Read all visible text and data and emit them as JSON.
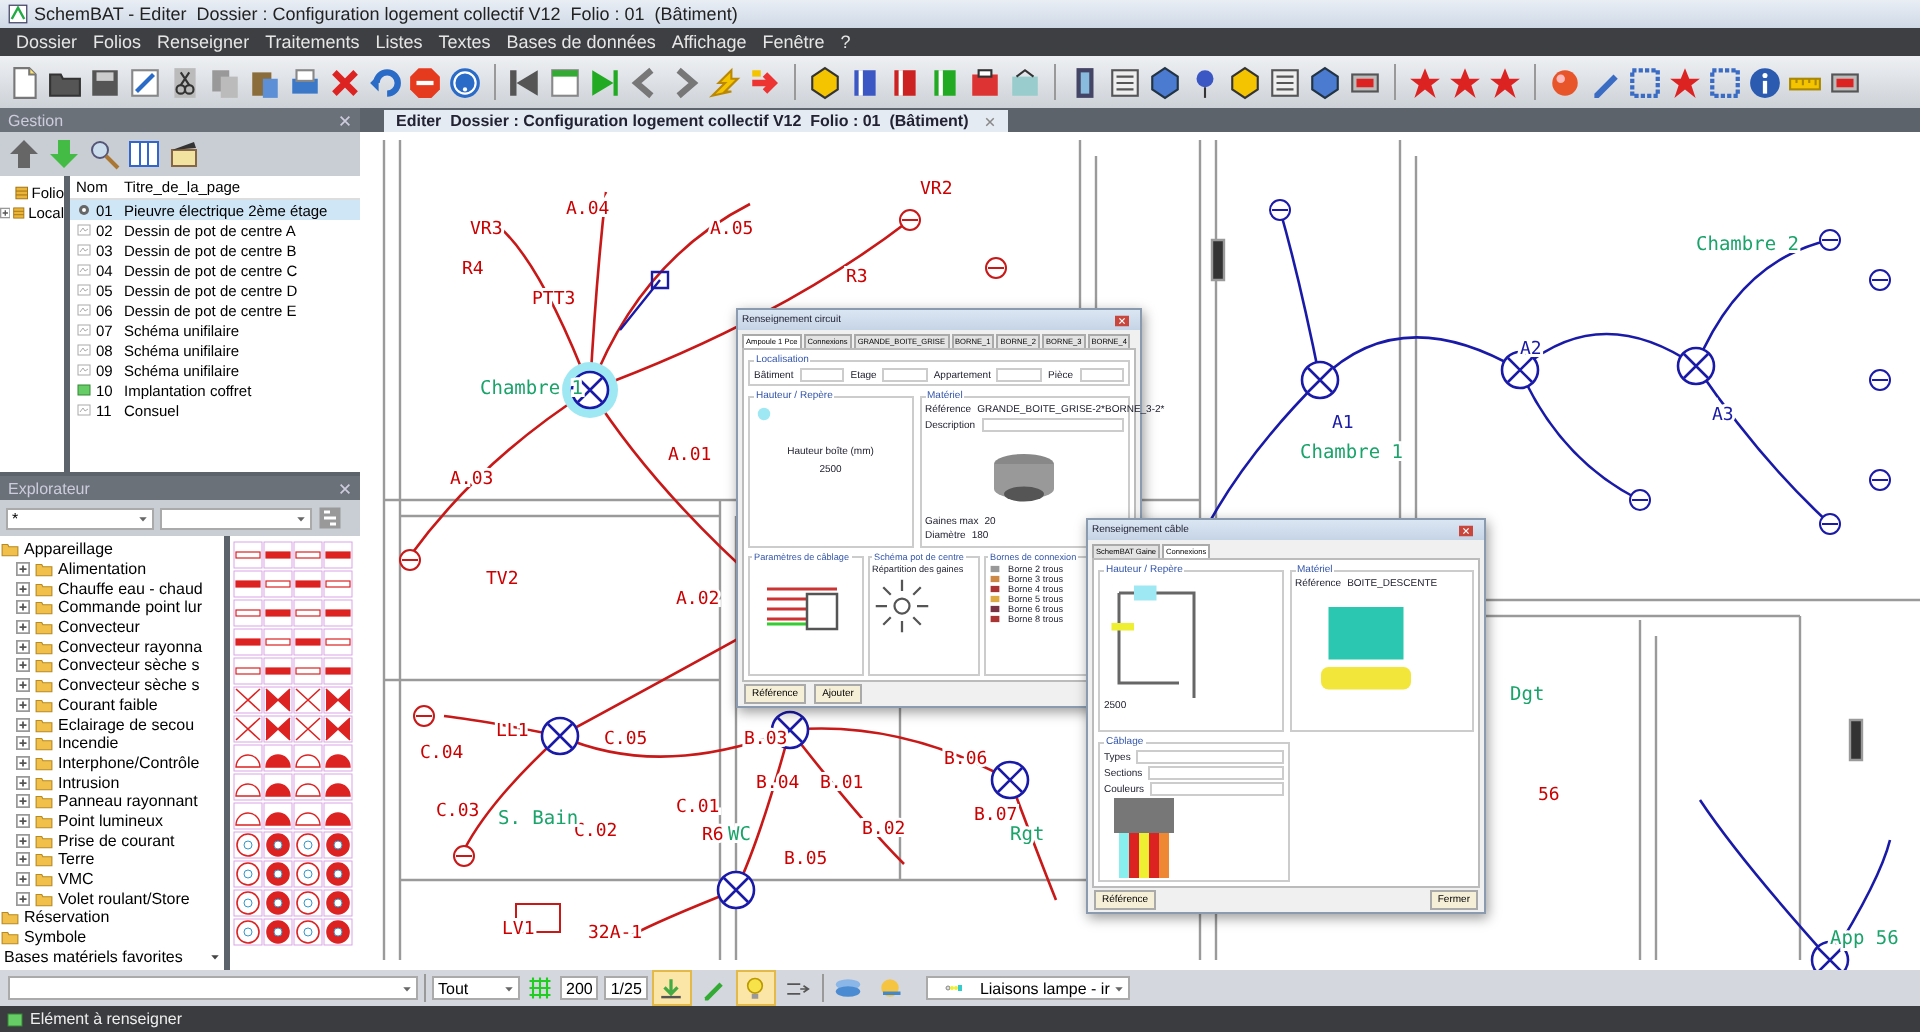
{
  "window": {
    "title": "SchemBAT - Editer  Dossier : Configuration logement collectif V12  Folio : 01  (Bâtiment)"
  },
  "menu": [
    "Dossier",
    "Folios",
    "Renseigner",
    "Traitements",
    "Listes",
    "Textes",
    "Bases de données",
    "Affichage",
    "Fenêtre",
    "?"
  ],
  "gestion": {
    "title": "Gestion",
    "tree": [
      {
        "label": "Folio"
      },
      {
        "label": "Local",
        "expanded": false
      }
    ],
    "columns": [
      "Nom",
      "Titre_de_la_page"
    ],
    "rows": [
      {
        "num": "01",
        "title": "Pieuvre électrique 2ème étage",
        "kind": "main",
        "selected": true
      },
      {
        "num": "02",
        "title": "Dessin de pot de centre A",
        "kind": "sheet",
        "selected": false
      },
      {
        "num": "03",
        "title": "Dessin de pot de centre B",
        "kind": "sheet",
        "selected": false
      },
      {
        "num": "04",
        "title": "Dessin de pot de centre C",
        "kind": "sheet",
        "selected": false
      },
      {
        "num": "05",
        "title": "Dessin de pot de centre D",
        "kind": "sheet",
        "selected": false
      },
      {
        "num": "06",
        "title": "Dessin de pot de centre E",
        "kind": "sheet",
        "selected": false
      },
      {
        "num": "07",
        "title": "Schéma unifilaire",
        "kind": "sheet",
        "selected": false
      },
      {
        "num": "08",
        "title": "Schéma unifilaire",
        "kind": "sheet",
        "selected": false
      },
      {
        "num": "09",
        "title": "Schéma unifilaire",
        "kind": "sheet",
        "selected": false
      },
      {
        "num": "10",
        "title": "Implantation coffret",
        "kind": "plan",
        "selected": false
      },
      {
        "num": "11",
        "title": "Consuel",
        "kind": "sheet",
        "selected": false
      }
    ]
  },
  "explorer": {
    "title": "Explorateur",
    "filter": "*",
    "tree": [
      {
        "label": "Appareillage",
        "children": [
          {
            "label": "Alimentation",
            "expanded": false
          },
          {
            "label": "Chauffe eau - chaud",
            "expanded": false
          },
          {
            "label": "Commande point lur",
            "expanded": false
          },
          {
            "label": "Convecteur",
            "expanded": false
          },
          {
            "label": "Convecteur rayonna",
            "expanded": false
          },
          {
            "label": "Convecteur sèche s",
            "expanded": false
          },
          {
            "label": "Convecteur sèche s",
            "expanded": false
          },
          {
            "label": "Courant faible",
            "expanded": false
          },
          {
            "label": "Eclairage de secou",
            "expanded": false
          },
          {
            "label": "Incendie",
            "expanded": false
          },
          {
            "label": "Interphone/Contrôle",
            "expanded": false
          },
          {
            "label": "Intrusion",
            "expanded": false
          },
          {
            "label": "Panneau rayonnant",
            "expanded": false
          },
          {
            "label": "Point lumineux",
            "expanded": false
          },
          {
            "label": "Prise de courant",
            "expanded": false
          },
          {
            "label": "Terre",
            "expanded": false
          },
          {
            "label": "VMC",
            "expanded": false
          },
          {
            "label": "Volet roulant/Store",
            "expanded": false
          }
        ]
      },
      {
        "label": "Réservation"
      },
      {
        "label": "Symbole"
      }
    ],
    "favorites": "Bases matériels favorites"
  },
  "document_tab": {
    "title": "Editer  Dossier : Configuration logement collectif V12  Folio : 01  (Bâtiment)"
  },
  "canvas": {
    "labels": [
      {
        "text": "VR3",
        "kind": "circuit",
        "color": "#cc0000"
      },
      {
        "text": "R4",
        "kind": "circuit",
        "color": "#cc0000"
      },
      {
        "text": "PTT3",
        "kind": "circuit",
        "color": "#cc0000"
      },
      {
        "text": "A.04",
        "kind": "circuit",
        "color": "#cc0000"
      },
      {
        "text": "A.05",
        "kind": "circuit",
        "color": "#cc0000"
      },
      {
        "text": "VR2",
        "kind": "circuit",
        "color": "#cc0000"
      },
      {
        "text": "R3",
        "kind": "circuit",
        "color": "#cc0000"
      },
      {
        "text": "Chambre 1",
        "kind": "room",
        "color": "#1aa36a"
      },
      {
        "text": "A.03",
        "kind": "circuit",
        "color": "#cc0000"
      },
      {
        "text": "A.01",
        "kind": "circuit",
        "color": "#cc0000"
      },
      {
        "text": "TV2",
        "kind": "circuit",
        "color": "#cc0000"
      },
      {
        "text": "A.02",
        "kind": "circuit",
        "color": "#cc0000"
      },
      {
        "text": "LL1",
        "kind": "circuit",
        "color": "#cc0000"
      },
      {
        "text": "C.04",
        "kind": "circuit",
        "color": "#cc0000"
      },
      {
        "text": "C.03",
        "kind": "circuit",
        "color": "#cc0000"
      },
      {
        "text": "C.05",
        "kind": "circuit",
        "color": "#cc0000"
      },
      {
        "text": "C.02",
        "kind": "circuit",
        "color": "#cc0000"
      },
      {
        "text": "C.01",
        "kind": "circuit",
        "color": "#cc0000"
      },
      {
        "text": "S. Bain",
        "kind": "room",
        "color": "#1aa36a"
      },
      {
        "text": "R6",
        "kind": "circuit",
        "color": "#cc0000"
      },
      {
        "text": "WC",
        "kind": "room",
        "color": "#1aa36a"
      },
      {
        "text": "B.03",
        "kind": "circuit",
        "color": "#cc0000"
      },
      {
        "text": "B.04",
        "kind": "circuit",
        "color": "#cc0000"
      },
      {
        "text": "B.05",
        "kind": "circuit",
        "color": "#cc0000"
      },
      {
        "text": "B.01",
        "kind": "circuit",
        "color": "#cc0000"
      },
      {
        "text": "B.02",
        "kind": "circuit",
        "color": "#cc0000"
      },
      {
        "text": "B.06",
        "kind": "circuit",
        "color": "#cc0000"
      },
      {
        "text": "B.07",
        "kind": "circuit",
        "color": "#cc0000"
      },
      {
        "text": "Rgt",
        "kind": "room",
        "color": "#1aa36a"
      },
      {
        "text": "LV1",
        "kind": "circuit",
        "color": "#cc0000"
      },
      {
        "text": "32A-1",
        "kind": "circuit",
        "color": "#cc0000"
      },
      {
        "text": "Chambre 2",
        "kind": "room",
        "color": "#1aa36a"
      },
      {
        "text": "A1",
        "kind": "circuit",
        "color": "#1a1aa8"
      },
      {
        "text": "A2",
        "kind": "circuit",
        "color": "#1a1aa8"
      },
      {
        "text": "A3",
        "kind": "circuit",
        "color": "#1a1aa8"
      },
      {
        "text": "Chambre 1",
        "kind": "room",
        "color": "#1aa36a"
      },
      {
        "text": "Dgt",
        "kind": "room",
        "color": "#1aa36a"
      },
      {
        "text": "56",
        "kind": "circuit",
        "color": "#cc0000"
      },
      {
        "text": "App 56",
        "kind": "room",
        "color": "#1aa36a"
      }
    ]
  },
  "dialogs": [
    {
      "kind": "circuit",
      "title": "Renseignement circuit",
      "tabs": [
        {
          "label": "Ampoule 1 Pce",
          "selected": true
        },
        {
          "label": "Connexions",
          "selected": false
        },
        {
          "label": "GRANDE_BOITE_GRISE",
          "selected": false
        },
        {
          "label": "BORNE_1",
          "selected": false
        },
        {
          "label": "BORNE_2",
          "selected": false
        },
        {
          "label": "BORNE_3",
          "selected": false
        },
        {
          "label": "BORNE_4",
          "selected": false
        }
      ],
      "localisation": {
        "title": "Localisation",
        "fields": [
          "Bâtiment",
          "Etage",
          "Appartement",
          "Pièce"
        ]
      },
      "height": {
        "title": "Hauteur / Repère",
        "label": "Hauteur boîte (mm)",
        "value": "2500"
      },
      "material": {
        "title": "Matériel",
        "reference_label": "Référence",
        "reference": "GRANDE_BOITE_GRISE-2*BORNE_3-2*",
        "description_label": "Description",
        "stats": [
          {
            "label": "Gaines max",
            "value": "20"
          },
          {
            "label": "Diamètre",
            "value": "180"
          }
        ]
      },
      "cabling": {
        "title": "Paramètres de câblage"
      },
      "pot": {
        "title": "Schéma pot de centre",
        "label": "Répartition des gaines"
      },
      "terminals": {
        "title": "Bornes de connexion",
        "items": [
          "Borne 2 trous",
          "Borne 3 trous",
          "Borne 4 trous",
          "Borne 5 trous",
          "Borne 6 trous",
          "Borne 8 trous"
        ]
      },
      "buttons": [
        "Référence",
        "Ajouter"
      ]
    },
    {
      "kind": "cable",
      "title": "Renseignement câble",
      "tabs": [
        {
          "label": "SchemBAT Gaine",
          "selected": false
        },
        {
          "label": "Connexions",
          "selected": true
        }
      ],
      "height": {
        "title": "Hauteur / Repère",
        "value": "2500"
      },
      "material": {
        "title": "Matériel",
        "reference_label": "Référence",
        "reference": "BOITE_DESCENTE"
      },
      "cabling": {
        "title": "Câblage",
        "fields": [
          "Types",
          "Sections",
          "Couleurs"
        ]
      },
      "buttons": [
        "Référence",
        "Fermer"
      ]
    }
  ],
  "bottom_bar": {
    "filter": "Tout",
    "zoom": "200",
    "scale": "1/25",
    "tools": [
      {
        "kind": "level",
        "on": true
      },
      {
        "kind": "pencil",
        "on": false
      },
      {
        "kind": "bulb",
        "on": true
      },
      {
        "kind": "swap",
        "on": false
      }
    ],
    "layer": "Liaisons lampe - ir"
  },
  "status_bar": {
    "text": "Elément à renseigner"
  }
}
